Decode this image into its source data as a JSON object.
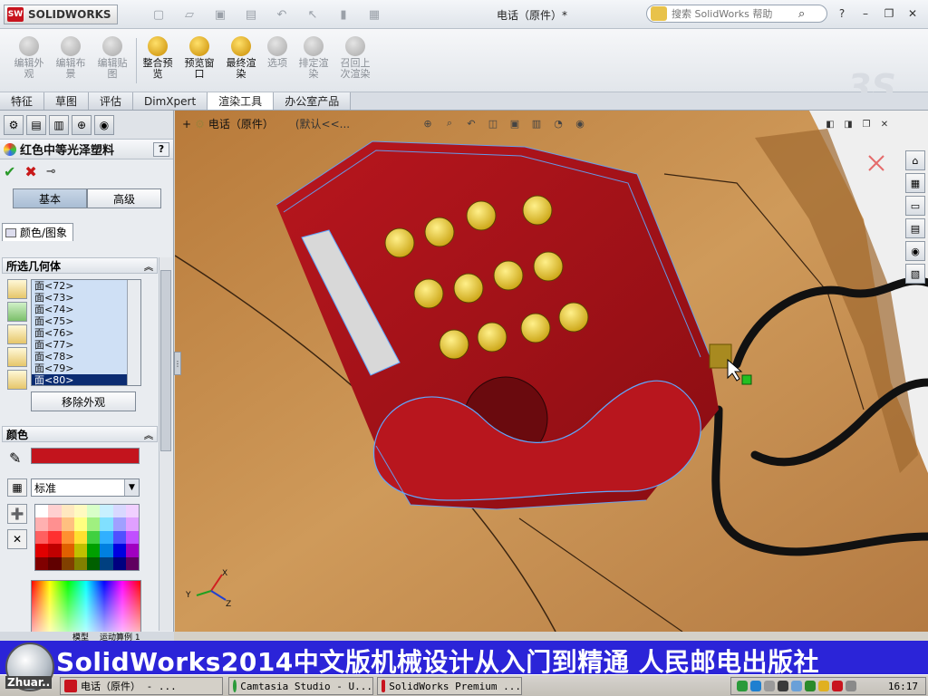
{
  "app": {
    "logo_text": "SOLIDWORKS",
    "logo_badge": "SW",
    "document_title": "电话（原件）*",
    "help_search_placeholder": "搜索 SolidWorks 帮助",
    "window_controls": [
      "?",
      "–",
      "❐",
      "✕"
    ]
  },
  "quick_access": [
    "new-icon",
    "open-icon",
    "save-icon",
    "print-icon",
    "undo-icon",
    "select-icon",
    "rebuild-icon",
    "options-icon"
  ],
  "commands": [
    {
      "label_1": "编辑外",
      "label_2": "观",
      "enabled": false
    },
    {
      "label_1": "编辑布",
      "label_2": "景",
      "enabled": false
    },
    {
      "label_1": "编辑贴",
      "label_2": "图",
      "enabled": false
    },
    {
      "label_1": "整合预",
      "label_2": "览",
      "enabled": true
    },
    {
      "label_1": "预览窗",
      "label_2": "口",
      "enabled": true
    },
    {
      "label_1": "最终渲",
      "label_2": "染",
      "enabled": true
    },
    {
      "label_1": "选项",
      "label_2": "",
      "enabled": false
    },
    {
      "label_1": "排定渲",
      "label_2": "染",
      "enabled": false
    },
    {
      "label_1": "召回上",
      "label_2": "次渲染",
      "enabled": false
    }
  ],
  "tabs": [
    "特征",
    "草图",
    "评估",
    "DimXpert",
    "渲染工具",
    "办公室产品"
  ],
  "active_tab": "渲染工具",
  "panel": {
    "title": "红色中等光泽塑料",
    "help": "?",
    "basic_label": "基本",
    "advanced_label": "高级",
    "subtab_label": "颜色/图象",
    "geometry_header": "所选几何体",
    "faces": [
      "面<72>",
      "面<73>",
      "面<74>",
      "面<75>",
      "面<76>",
      "面<77>",
      "面<78>",
      "面<79>",
      "面<80>"
    ],
    "selected_face": "面<80>",
    "remove_label": "移除外观",
    "color_header": "颜色",
    "color_value": "#c3141d",
    "palette_select": "标准",
    "bottom_tab_1": "模型",
    "bottom_tab_2": "运动算例 1"
  },
  "palette_colors": [
    "#ffffff",
    "#ffd0d0",
    "#ffe8c0",
    "#fffac0",
    "#d8ffc8",
    "#c8f0ff",
    "#d8d8ff",
    "#f0d0ff",
    "#ffb0b0",
    "#ff9090",
    "#ffc080",
    "#ffff80",
    "#a0f080",
    "#80e0ff",
    "#a0a0ff",
    "#e0a0ff",
    "#ff6060",
    "#ff3030",
    "#ff9030",
    "#ffe030",
    "#40d040",
    "#30b0ff",
    "#5050ff",
    "#c050ff",
    "#e00000",
    "#c00000",
    "#e06000",
    "#c0c000",
    "#00a000",
    "#0080e0",
    "#0000e0",
    "#a000c0",
    "#800000",
    "#600000",
    "#804000",
    "#808000",
    "#006000",
    "#004080",
    "#000080",
    "#600060"
  ],
  "viewport": {
    "breadcrumb": "电话（原件）",
    "config": "(默认<<...",
    "triad_x": "X",
    "triad_y": "Y",
    "triad_z": "Z"
  },
  "banner": {
    "text": "SolidWorks2014中文版机械设计从入门到精通  人民邮电出版社",
    "logo_text": "Zhuar.."
  },
  "taskbar": {
    "tasks": [
      "电话（原件） - ...",
      "Camtasia Studio - U...",
      "SolidWorks Premium ..."
    ],
    "clock": "16:17"
  },
  "colors": {
    "phone_body": "#a8121a",
    "button_yellow": "#e8c52a",
    "wood": "#c08a4c",
    "banner_blue": "#2b24d8",
    "wireframe_blue": "#5fa8ff"
  }
}
